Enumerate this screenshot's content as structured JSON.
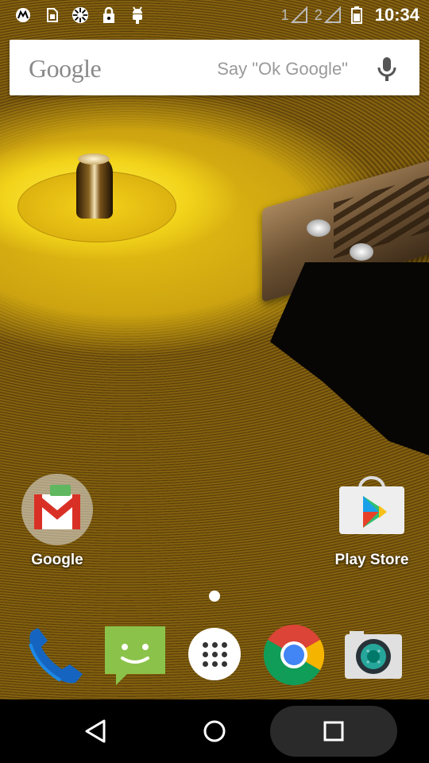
{
  "status_bar": {
    "icons_left": [
      "motorola-icon",
      "sim-card-icon",
      "settings-gear-icon",
      "lock-icon",
      "android-debug-icon"
    ],
    "signal_1_label": "1",
    "signal_2_label": "2",
    "battery_icon": "battery-icon",
    "time": "10:34"
  },
  "search_bar": {
    "logo_text": "Google",
    "hint": "Say \"Ok Google\"",
    "mic_icon": "mic-icon"
  },
  "desktop": {
    "apps": [
      {
        "label": "Google",
        "icon": "google-folder-icon"
      },
      {
        "label": "Play Store",
        "icon": "play-store-icon"
      }
    ],
    "page_indicator": "page-dot"
  },
  "dock": {
    "items": [
      "phone-icon",
      "messaging-icon",
      "app-drawer-icon",
      "chrome-icon",
      "camera-icon"
    ]
  },
  "navbar": {
    "buttons": [
      "back-icon",
      "home-icon",
      "recents-icon"
    ]
  },
  "colors": {
    "accent_yellow": "#f2d31a",
    "gmail_red": "#d93025",
    "chrome_blue": "#4285f4",
    "messaging_green": "#8bc34a"
  }
}
